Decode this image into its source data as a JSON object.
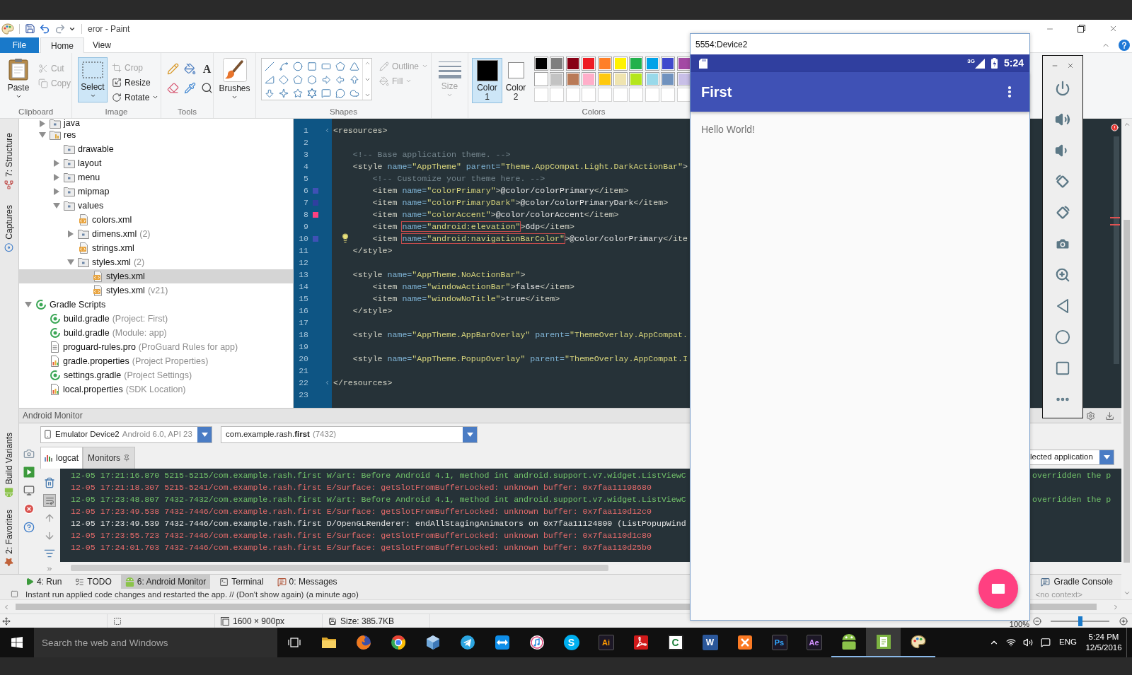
{
  "window": {
    "title": "eror - Paint"
  },
  "ribbon_tabs": [
    {
      "label": "File",
      "kind": "menu",
      "selected": false
    },
    {
      "label": "Home",
      "kind": "tab",
      "selected": true
    },
    {
      "label": "View",
      "kind": "tab",
      "selected": false
    }
  ],
  "ribbon": {
    "clipboard": {
      "label": "Clipboard",
      "paste": "Paste",
      "cut": {
        "label": "Cut",
        "disabled": true
      },
      "copy": {
        "label": "Copy",
        "disabled": true
      }
    },
    "image": {
      "label": "Image",
      "select": {
        "label": "Select",
        "selected": true
      },
      "crop": {
        "label": "Crop",
        "disabled": true
      },
      "resize": {
        "label": "Resize",
        "disabled": false
      },
      "rotate": {
        "label": "Rotate",
        "disabled": false
      }
    },
    "tools": {
      "label": "Tools",
      "text_tool": "A"
    },
    "brushes": {
      "label": "Brushes"
    },
    "shapes": {
      "label": "Shapes",
      "outline": {
        "label": "Outline",
        "disabled": true
      },
      "fill": {
        "label": "Fill",
        "disabled": true
      }
    },
    "size": {
      "label": "Size",
      "disabled": true
    },
    "color_1": {
      "label": "Color 1",
      "color": "#000000",
      "selected": true
    },
    "color_2": {
      "label": "Color 2",
      "color": "#ffffff",
      "selected": false
    },
    "colors": {
      "label": "Colors",
      "swatches": [
        {
          "color": "#000000"
        },
        {
          "color": "#7f7f7f"
        },
        {
          "color": "#880015"
        },
        {
          "color": "#ed1c24"
        },
        {
          "color": "#ff7f27"
        },
        {
          "color": "#fff200"
        },
        {
          "color": "#22b14c"
        },
        {
          "color": "#00a2e8"
        },
        {
          "color": "#3f48cc"
        },
        {
          "color": "#a349a4"
        },
        {
          "color": "#ffffff"
        },
        {
          "color": "#c3c3c3"
        },
        {
          "color": "#b97a57"
        },
        {
          "color": "#ffaec9"
        },
        {
          "color": "#ffc90e"
        },
        {
          "color": "#efe4b0"
        },
        {
          "color": "#b5e61d"
        },
        {
          "color": "#99d9ea"
        },
        {
          "color": "#7092be"
        },
        {
          "color": "#c8bfe7"
        }
      ]
    }
  },
  "ide": {
    "side_tabs": [
      {
        "label": "7: Structure",
        "kind": "structure"
      },
      {
        "label": "Captures",
        "kind": "captures"
      }
    ],
    "bottom_side_tabs": [
      {
        "label": "Build Variants",
        "kind": "android"
      },
      {
        "label": "2: Favorites",
        "kind": "star"
      }
    ],
    "project_tree": {
      "continued_children": [
        {
          "label": "java",
          "kind": "folder",
          "expanded": false,
          "selected": false
        },
        {
          "label": "res",
          "kind": "res-folder",
          "expanded": true,
          "selected": false,
          "children": [
            {
              "label": "drawable",
              "kind": "folder",
              "selected": false
            },
            {
              "label": "layout",
              "kind": "folder",
              "expanded": false,
              "selected": false
            },
            {
              "label": "menu",
              "kind": "folder",
              "expanded": false,
              "selected": false
            },
            {
              "label": "mipmap",
              "kind": "folder",
              "expanded": false,
              "selected": false
            },
            {
              "label": "values",
              "kind": "folder",
              "expanded": true,
              "selected": false,
              "children": [
                {
                  "label": "colors.xml",
                  "kind": "xml",
                  "selected": false
                },
                {
                  "label": "dimens.xml",
                  "note": "(2)",
                  "kind": "folder",
                  "expanded": false,
                  "selected": false
                },
                {
                  "label": "strings.xml",
                  "kind": "xml",
                  "selected": false
                },
                {
                  "label": "styles.xml",
                  "note": "(2)",
                  "kind": "folder",
                  "expanded": true,
                  "selected": false,
                  "children": [
                    {
                      "label": "styles.xml",
                      "kind": "xml",
                      "selected": true
                    },
                    {
                      "label": "styles.xml",
                      "note": "(v21)",
                      "kind": "xml",
                      "selected": false
                    }
                  ]
                }
              ]
            }
          ]
        }
      ],
      "items": [
        {
          "label": "Gradle Scripts",
          "kind": "gradle",
          "expanded": true,
          "selected": false,
          "children": [
            {
              "label": "build.gradle",
              "note": "(Project: First)",
              "kind": "gradle",
              "selected": false
            },
            {
              "label": "build.gradle",
              "note": "(Module: app)",
              "kind": "gradle",
              "selected": false
            },
            {
              "label": "proguard-rules.pro",
              "note": "(ProGuard Rules for app)",
              "kind": "text-file",
              "selected": false
            },
            {
              "label": "gradle.properties",
              "note": "(Project Properties)",
              "kind": "properties",
              "selected": false
            },
            {
              "label": "settings.gradle",
              "note": "(Project Settings)",
              "kind": "gradle",
              "selected": false
            },
            {
              "label": "local.properties",
              "note": "(SDK Location)",
              "kind": "properties",
              "selected": false
            }
          ]
        }
      ]
    },
    "editor": {
      "lines": [
        {
          "number": "1",
          "fold": true,
          "segments": [
            {
              "kind": "tag",
              "text": "<resources>"
            }
          ]
        },
        {
          "number": "2"
        },
        {
          "number": "3",
          "segments": [
            {
              "kind": "comment",
              "text": "    <!-- Base application theme. -->"
            }
          ]
        },
        {
          "number": "4",
          "segments": [
            {
              "kind": "tag",
              "text": "    <style"
            },
            {
              "kind": "attr",
              "text": " name="
            },
            {
              "kind": "value",
              "text": "\"AppTheme\""
            },
            {
              "kind": "attr",
              "text": " parent="
            },
            {
              "kind": "value",
              "text": "\"Theme.AppCompat.Light.DarkActionBar\""
            },
            {
              "kind": "tag",
              "text": ">"
            }
          ]
        },
        {
          "number": "5",
          "segments": [
            {
              "kind": "comment",
              "text": "        <!-- Customize your theme here. -->"
            }
          ]
        },
        {
          "number": "6",
          "color": "#3f51b5",
          "segments": [
            {
              "kind": "tag",
              "text": "        <item"
            },
            {
              "kind": "attr",
              "text": " name="
            },
            {
              "kind": "value",
              "text": "\"colorPrimary\""
            },
            {
              "kind": "tag",
              "text": ">"
            },
            {
              "kind": "text",
              "text": "@color/colorPrimary"
            },
            {
              "kind": "tag",
              "text": "</item>"
            }
          ]
        },
        {
          "number": "7",
          "color": "#303f9f",
          "segments": [
            {
              "kind": "tag",
              "text": "        <item"
            },
            {
              "kind": "attr",
              "text": " name="
            },
            {
              "kind": "value",
              "text": "\"colorPrimaryDark\""
            },
            {
              "kind": "tag",
              "text": ">"
            },
            {
              "kind": "text",
              "text": "@color/colorPrimaryDark"
            },
            {
              "kind": "tag",
              "text": "</item>"
            }
          ]
        },
        {
          "number": "8",
          "color": "#ff4081",
          "segments": [
            {
              "kind": "tag",
              "text": "        <item"
            },
            {
              "kind": "attr",
              "text": " name="
            },
            {
              "kind": "value",
              "text": "\"colorAccent\""
            },
            {
              "kind": "tag",
              "text": ">"
            },
            {
              "kind": "text",
              "text": "@color/colorAccent"
            },
            {
              "kind": "tag",
              "text": "</item>"
            }
          ]
        },
        {
          "number": "9",
          "segments": [
            {
              "kind": "tag",
              "text": "        <item "
            },
            {
              "kind": "attr",
              "text": "name=",
              "error": true
            },
            {
              "kind": "value",
              "text": "\"android:elevation\"",
              "error": true
            },
            {
              "kind": "tag",
              "text": ">"
            },
            {
              "kind": "text",
              "text": "6dp"
            },
            {
              "kind": "tag",
              "text": "</item>"
            }
          ]
        },
        {
          "number": "10",
          "color": "#3f51b5",
          "bulb": true,
          "segments": [
            {
              "kind": "tag",
              "text": "        <item "
            },
            {
              "kind": "attr",
              "text": "name=",
              "error": true
            },
            {
              "kind": "value",
              "text": "\"android:navigationBarColor\"",
              "error": true
            },
            {
              "kind": "tag",
              "text": ">"
            },
            {
              "kind": "text",
              "text": "@color/colorPrimary"
            },
            {
              "kind": "tag",
              "text": "</ite"
            }
          ]
        },
        {
          "number": "11",
          "segments": [
            {
              "kind": "tag",
              "text": "    </style>"
            }
          ]
        },
        {
          "number": "12"
        },
        {
          "number": "13",
          "segments": [
            {
              "kind": "tag",
              "text": "    <style"
            },
            {
              "kind": "attr",
              "text": " name="
            },
            {
              "kind": "value",
              "text": "\"AppTheme.NoActionBar\""
            },
            {
              "kind": "tag",
              "text": ">"
            }
          ]
        },
        {
          "number": "14",
          "segments": [
            {
              "kind": "tag",
              "text": "        <item"
            },
            {
              "kind": "attr",
              "text": " name="
            },
            {
              "kind": "value",
              "text": "\"windowActionBar\""
            },
            {
              "kind": "tag",
              "text": ">"
            },
            {
              "kind": "text",
              "text": "false"
            },
            {
              "kind": "tag",
              "text": "</item>"
            }
          ]
        },
        {
          "number": "15",
          "segments": [
            {
              "kind": "tag",
              "text": "        <item"
            },
            {
              "kind": "attr",
              "text": " name="
            },
            {
              "kind": "value",
              "text": "\"windowNoTitle\""
            },
            {
              "kind": "tag",
              "text": ">"
            },
            {
              "kind": "text",
              "text": "true"
            },
            {
              "kind": "tag",
              "text": "</item>"
            }
          ]
        },
        {
          "number": "16",
          "segments": [
            {
              "kind": "tag",
              "text": "    </style>"
            }
          ]
        },
        {
          "number": "17"
        },
        {
          "number": "18",
          "segments": [
            {
              "kind": "tag",
              "text": "    <style"
            },
            {
              "kind": "attr",
              "text": " name="
            },
            {
              "kind": "value",
              "text": "\"AppTheme.AppBarOverlay\""
            },
            {
              "kind": "attr",
              "text": " parent="
            },
            {
              "kind": "value",
              "text": "\"ThemeOverlay.AppCompat."
            }
          ]
        },
        {
          "number": "19"
        },
        {
          "number": "20",
          "segments": [
            {
              "kind": "tag",
              "text": "    <style"
            },
            {
              "kind": "attr",
              "text": " name="
            },
            {
              "kind": "value",
              "text": "\"AppTheme.PopupOverlay\""
            },
            {
              "kind": "attr",
              "text": " parent="
            },
            {
              "kind": "value",
              "text": "\"ThemeOverlay.AppCompat.I"
            }
          ]
        },
        {
          "number": "21"
        },
        {
          "number": "22",
          "fold": true,
          "segments": [
            {
              "kind": "tag",
              "text": "</resources>"
            }
          ]
        },
        {
          "number": "23"
        }
      ]
    },
    "android_monitor": {
      "title": "Android Monitor",
      "device": {
        "name": "Emulator Device2",
        "detail": "Android 6.0, API 23"
      },
      "process": {
        "name": "com.example.rash.**first**",
        "pid": "(7432)"
      },
      "tabs": [
        {
          "label": "logcat",
          "selected": true
        },
        {
          "label": "Monitors",
          "selected": false
        }
      ],
      "filter": "lected application",
      "soft_wraps": {
        "on": true
      },
      "log": [
        {
          "kind": "warning",
          "text": "12-05 17:21:16.870 5215-5215/com.example.rash.first W/art: Before Android 4.1, method int android.support.v7.widget.ListViewC",
          "tail": "overridden the p"
        },
        {
          "kind": "error",
          "text": "12-05 17:21:18.307 5215-5241/com.example.rash.first E/Surface: getSlotFromBufferLocked: unknown buffer: 0x7faa11198680"
        },
        {
          "kind": "warning",
          "text": "12-05 17:23:48.807 7432-7432/com.example.rash.first W/art: Before Android 4.1, method int android.support.v7.widget.ListViewC",
          "tail": "overridden the p"
        },
        {
          "kind": "error",
          "text": "12-05 17:23:49.538 7432-7446/com.example.rash.first E/Surface: getSlotFromBufferLocked: unknown buffer: 0x7faa110d12c0"
        },
        {
          "kind": "debug",
          "text": "12-05 17:23:49.539 7432-7446/com.example.rash.first D/OpenGLRenderer: endAllStagingAnimators on 0x7faa11124800 (ListPopupWind"
        },
        {
          "kind": "error",
          "text": "12-05 17:23:55.723 7432-7446/com.example.rash.first E/Surface: getSlotFromBufferLocked: unknown buffer: 0x7faa110d1c80"
        },
        {
          "kind": "error",
          "text": "12-05 17:24:01.703 7432-7446/com.example.rash.first E/Surface: getSlotFromBufferLocked: unknown buffer: 0x7faa110d25b0"
        }
      ]
    },
    "tool_tabs": [
      {
        "label": "4: Run",
        "kind": "run",
        "selected": false
      },
      {
        "label": "TODO",
        "kind": "todo",
        "selected": false
      },
      {
        "label": "6: Android Monitor",
        "kind": "android",
        "selected": true
      },
      {
        "label": "Terminal",
        "kind": "terminal",
        "selected": false
      },
      {
        "label": "0: Messages",
        "kind": "messages",
        "selected": false
      }
    ],
    "right_tool_tabs": [
      {
        "label": "Gradle Console",
        "kind": "console",
        "selected": false
      }
    ],
    "status_message": "Instant run applied code changes and restarted the app. // (Don't show again) (a minute ago)",
    "status_context": "<no context>"
  },
  "emulator": {
    "title": "5554:Device2",
    "phone": {
      "network": "3G",
      "time": "5:24",
      "app_title": "First",
      "text": "Hello World!"
    }
  },
  "status_bar": {
    "dimensions": "1600 × 900px",
    "file_size": "Size: 385.7KB",
    "zoom": "100%",
    "zoom_slider": {
      "level": 0.5
    }
  },
  "taskbar": {
    "search": {
      "placeholder": "Search the web and Windows"
    },
    "apps": [
      {
        "kind": "folder",
        "running": false,
        "selected": false
      },
      {
        "kind": "orange-globe",
        "running": false,
        "selected": false
      },
      {
        "kind": "color-ring",
        "running": false,
        "selected": false
      },
      {
        "kind": "cube",
        "running": false,
        "selected": false
      },
      {
        "kind": "plane",
        "running": false,
        "selected": false
      },
      {
        "kind": "arrows",
        "running": false,
        "selected": false
      },
      {
        "kind": "music",
        "running": false,
        "selected": false
      },
      {
        "kind": "letter-disc",
        "glyph": "S",
        "color": "#00aff0",
        "running": false,
        "selected": false
      },
      {
        "kind": "dark-letter",
        "glyph": "Ai",
        "color": "#ff9a00",
        "running": false,
        "selected": false
      },
      {
        "kind": "pdf",
        "running": false,
        "selected": false
      },
      {
        "kind": "light-letter",
        "glyph": "C",
        "color": "#1b7f3a",
        "running": false,
        "selected": false
      },
      {
        "kind": "letter",
        "glyph": "W",
        "color": "#2b579a",
        "running": false,
        "selected": false
      },
      {
        "kind": "orange-tile",
        "running": false,
        "selected": false
      },
      {
        "kind": "dark-letter",
        "glyph": "Ps",
        "color": "#31a8ff",
        "running": false,
        "selected": false
      },
      {
        "kind": "dark-letter",
        "glyph": "Ae",
        "color": "#d291ff",
        "running": false,
        "selected": false
      },
      {
        "kind": "android",
        "running": true,
        "selected": false
      },
      {
        "kind": "green-panel",
        "running": true,
        "selected": true
      },
      {
        "kind": "palette",
        "running": true,
        "selected": false
      }
    ],
    "language": "ENG",
    "time": "5:24 PM",
    "date": "12/5/2016"
  }
}
